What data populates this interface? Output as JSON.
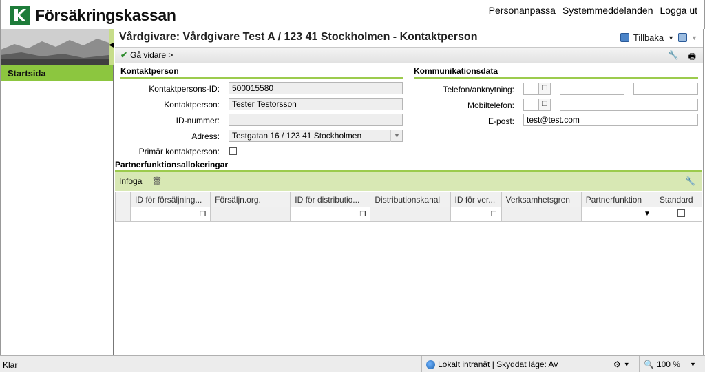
{
  "header": {
    "logo_text": "Försäkringskassan",
    "links": [
      "Personanpassa",
      "Systemmeddelanden",
      "Logga ut"
    ]
  },
  "sidebar": {
    "start_label": "Startsida"
  },
  "page": {
    "title": "Vårdgivare: Vårdgivare Test A / 123 41 Stockholmen - Kontaktperson",
    "back_label": "Tillbaka",
    "continue_label": "Gå vidare >"
  },
  "contact": {
    "section_title": "Kontaktperson",
    "id_label": "Kontaktpersons-ID:",
    "id_value": "500015580",
    "name_label": "Kontaktperson:",
    "name_value": "Tester Testorsson",
    "idnum_label": "ID-nummer:",
    "idnum_value": "",
    "address_label": "Adress:",
    "address_value": "Testgatan 16 / 123 41 Stockholmen",
    "primary_label": "Primär kontaktperson:"
  },
  "communication": {
    "section_title": "Kommunikationsdata",
    "phone_label": "Telefon/anknytning:",
    "mobile_label": "Mobiltelefon:",
    "email_label": "E-post:",
    "email_value": "test@test.com"
  },
  "partner": {
    "title": "Partnerfunktionsallokeringar",
    "insert_label": "Infoga",
    "columns": [
      "ID för försäljning...",
      "Försäljn.org.",
      "ID för distributio...",
      "Distributionskanal",
      "ID för ver...",
      "Verksamhetsgren",
      "Partnerfunktion",
      "Standard"
    ]
  },
  "status": {
    "left": "Klar",
    "zone": "Lokalt intranät | Skyddat läge: Av",
    "zoom": "100 %"
  },
  "colors": {
    "accent_green": "#8cc63f",
    "section_underline": "#9ccb4d",
    "logo_green": "#1e7c3a"
  }
}
